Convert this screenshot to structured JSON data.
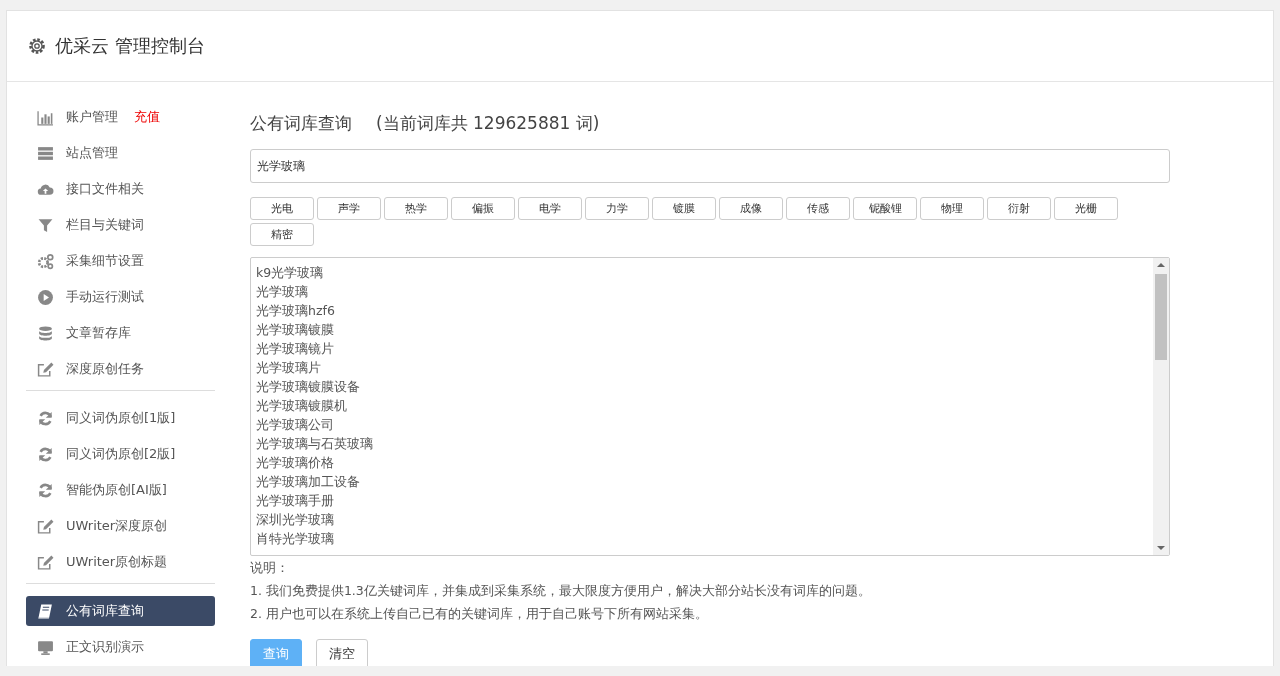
{
  "header": {
    "title": "优采云 管理控制台"
  },
  "sidebar": {
    "groups": [
      {
        "items": [
          {
            "kind": "chart",
            "label": "账户管理",
            "badge": "充值",
            "selected": false
          },
          {
            "kind": "server",
            "label": "站点管理",
            "selected": false
          },
          {
            "kind": "cloud",
            "label": "接口文件相关",
            "selected": false
          },
          {
            "kind": "filter",
            "label": "栏目与关键词",
            "selected": false
          },
          {
            "kind": "gears",
            "label": "采集细节设置",
            "selected": false
          },
          {
            "kind": "play",
            "label": "手动运行测试",
            "selected": false
          },
          {
            "kind": "database",
            "label": "文章暂存库",
            "selected": false
          },
          {
            "kind": "edit",
            "label": "深度原创任务",
            "selected": false
          }
        ]
      },
      {
        "items": [
          {
            "kind": "refresh",
            "label": "同义词伪原创[1版]",
            "selected": false
          },
          {
            "kind": "refresh",
            "label": "同义词伪原创[2版]",
            "selected": false
          },
          {
            "kind": "refresh",
            "label": "智能伪原创[AI版]",
            "selected": false
          },
          {
            "kind": "edit",
            "label": "UWriter深度原创",
            "selected": false
          },
          {
            "kind": "edit",
            "label": "UWriter原创标题",
            "selected": false
          }
        ]
      },
      {
        "items": [
          {
            "kind": "book",
            "label": "公有词库查询",
            "selected": true
          },
          {
            "kind": "monitor",
            "label": "正文识别演示",
            "selected": false
          }
        ]
      }
    ]
  },
  "main": {
    "title": "公有词库查询",
    "subtitle": "(当前词库共 129625881 词)",
    "search": {
      "value": "光学玻璃"
    },
    "tags": [
      "光电",
      "声学",
      "热学",
      "偏振",
      "电学",
      "力学",
      "镀膜",
      "成像",
      "传感",
      "铌酸锂",
      "物理",
      "衍射",
      "光栅",
      "精密"
    ],
    "results": [
      "k9光学玻璃",
      "光学玻璃",
      "光学玻璃hzf6",
      "光学玻璃镀膜",
      "光学玻璃镜片",
      "光学玻璃片",
      "光学玻璃镀膜设备",
      "光学玻璃镀膜机",
      "光学玻璃公司",
      "光学玻璃与石英玻璃",
      "光学玻璃价格",
      "光学玻璃加工设备",
      "光学玻璃手册",
      "深圳光学玻璃",
      "肖特光学玻璃"
    ],
    "notes_title": "说明：",
    "notes": [
      "1. 我们免费提供1.3亿关键词库，并集成到采集系统，最大限度方便用户，解决大部分站长没有词库的问题。",
      "2. 用户也可以在系统上传自己已有的关键词库，用于自己账号下所有网站采集。"
    ],
    "buttons": [
      {
        "label": "查询",
        "kind": "primary"
      },
      {
        "label": "清空",
        "kind": "default"
      }
    ]
  }
}
